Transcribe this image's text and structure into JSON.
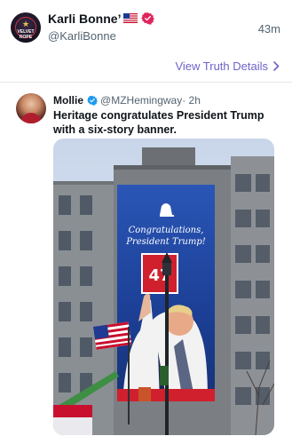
{
  "post": {
    "display_name": "Karli Bonne’",
    "handle": "@KarliBonne",
    "timestamp": "43m",
    "view_details_label": "View Truth Details",
    "avatar_text": "VELVET ROPE"
  },
  "quoted_post": {
    "author_name": "Mollie",
    "author_handle": "@MZHemingway",
    "age": "· 2h",
    "text": "Heritage congratulates President Trump with a six-story banner."
  },
  "banner": {
    "headline_line1": "Congratulations,",
    "headline_line2": "President Trump!",
    "number": "47"
  },
  "colors": {
    "accent_link": "#6e63c9",
    "verified_red": "#e0245e",
    "verified_blue": "#1d9bf0",
    "banner_blue": "#1c3f95",
    "banner_red": "#d0202e"
  }
}
